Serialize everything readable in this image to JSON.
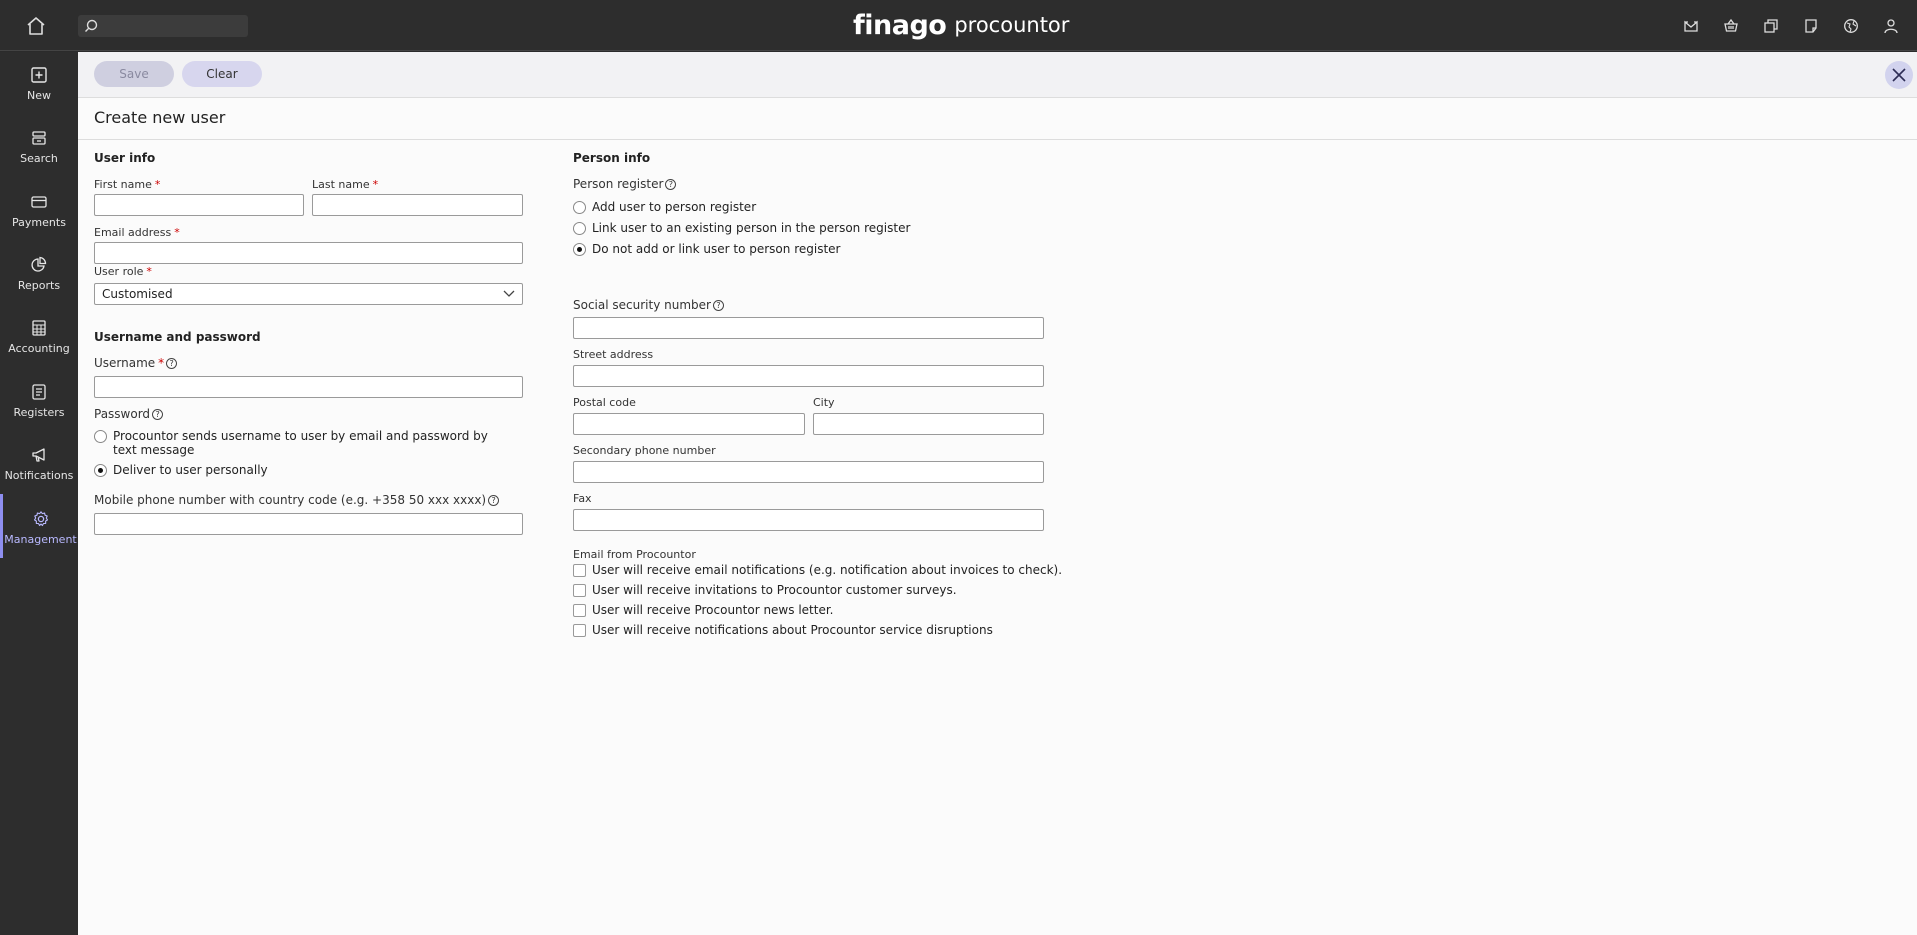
{
  "topbar": {
    "brand_main": "finago",
    "brand_sub": "procountor",
    "search_placeholder": ""
  },
  "sidebar": {
    "items": [
      {
        "label": "New",
        "icon": "plus-square-icon"
      },
      {
        "label": "Search",
        "icon": "stack-icon"
      },
      {
        "label": "Payments",
        "icon": "card-icon"
      },
      {
        "label": "Reports",
        "icon": "pie-chart-icon"
      },
      {
        "label": "Accounting",
        "icon": "calculator-icon"
      },
      {
        "label": "Registers",
        "icon": "list-icon"
      },
      {
        "label": "Notifications",
        "icon": "megaphone-icon"
      },
      {
        "label": "Management",
        "icon": "gear-icon",
        "active": true
      }
    ]
  },
  "toolbar": {
    "save_label": "Save",
    "clear_label": "Clear"
  },
  "page": {
    "title": "Create new user"
  },
  "user_info": {
    "heading": "User info",
    "first_name_label": "First name",
    "last_name_label": "Last name",
    "email_label": "Email address",
    "user_role_label": "User role",
    "user_role_value": "Customised",
    "required_mark": "*"
  },
  "credentials": {
    "heading": "Username and password",
    "username_label": "Username",
    "password_label": "Password",
    "password_options": [
      {
        "label": "Procountor sends username to user by email and password by text message",
        "selected": false
      },
      {
        "label": "Deliver to user personally",
        "selected": true
      }
    ],
    "mobile_label": "Mobile phone number with country code (e.g. +358 50 xxx xxxx)"
  },
  "person_info": {
    "heading": "Person info",
    "register_label": "Person register",
    "register_options": [
      {
        "label": "Add user to person register",
        "selected": false
      },
      {
        "label": "Link user to an existing person in the person register",
        "selected": false
      },
      {
        "label": "Do not add or link user to person register",
        "selected": true
      }
    ],
    "ssn_label": "Social security number",
    "street_label": "Street address",
    "postal_label": "Postal code",
    "city_label": "City",
    "phone2_label": "Secondary phone number",
    "fax_label": "Fax",
    "email_from_label": "Email from Procountor",
    "email_options": [
      {
        "label": "User will receive email notifications (e.g. notification about invoices to check).",
        "checked": false
      },
      {
        "label": "User will receive invitations to Procountor customer surveys.",
        "checked": false
      },
      {
        "label": "User will receive Procountor news letter.",
        "checked": false
      },
      {
        "label": "User will receive notifications about Procountor service disruptions",
        "checked": false
      }
    ]
  },
  "help_glyph": "?"
}
